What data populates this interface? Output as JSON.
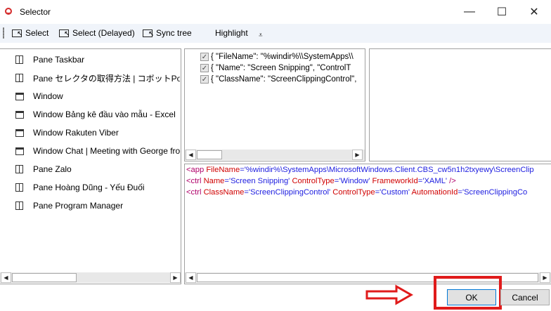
{
  "window": {
    "title": "Selector",
    "icon": "selector-app-icon",
    "controls": {
      "minimize": "—",
      "maximize": "☐",
      "close": "✕"
    }
  },
  "toolbar": {
    "select": "Select",
    "select_delayed": "Select (Delayed)",
    "sync_tree": "Sync tree",
    "highlight": "Highlight",
    "highlight_dropdown": "⩡"
  },
  "tree": {
    "items": [
      {
        "icon": "pane-icon",
        "label": "Pane Taskbar"
      },
      {
        "icon": "pane-icon",
        "label": "Pane セレクタの取得方法 | コボットPortal - "
      },
      {
        "icon": "window-icon",
        "label": "Window"
      },
      {
        "icon": "window-icon",
        "label": "Window Bảng kê đầu vào mẫu - Excel"
      },
      {
        "icon": "window-icon",
        "label": "Window Rakuten Viber"
      },
      {
        "icon": "window-icon",
        "label": "Window Chat | Meeting with George fro"
      },
      {
        "icon": "pane-icon",
        "label": "Pane Zalo"
      },
      {
        "icon": "pane-icon",
        "label": "Pane Hoàng Dũng - Yếu Đuối"
      },
      {
        "icon": "pane-icon",
        "label": "Pane Program Manager"
      }
    ]
  },
  "attributes": {
    "rows": [
      {
        "checked": true,
        "text": "{   \"FileName\": \"%windir%\\\\SystemApps\\\\"
      },
      {
        "checked": true,
        "text": "{   \"Name\": \"Screen Snipping\",    \"ControlT"
      },
      {
        "checked": true,
        "text": "{   \"ClassName\": \"ScreenClippingControl\","
      }
    ]
  },
  "xml": {
    "lines": [
      {
        "tag": "<app",
        "attr": "FileName",
        "value": "'%windir%\\SystemApps\\MicrosoftWindows.Client.CBS_cw5n1h2txyewy\\ScreenClip"
      },
      {
        "tag": "<ctrl",
        "attr": "Name",
        "value": "'Screen Snipping' ",
        "attr2": "ControlType",
        "value2": "'Window' ",
        "attr3": "FrameworkId",
        "value3": "'XAML' ",
        "end": "/>"
      },
      {
        "tag": "<ctrl",
        "attr": "ClassName",
        "value": "'ScreenClippingControl' ",
        "attr2": "ControlType",
        "value2": "'Custom' ",
        "attr3": "AutomationId",
        "value3": "'ScreenClippingCo"
      }
    ]
  },
  "buttons": {
    "ok": "OK",
    "cancel": "Cancel"
  },
  "scroll": {
    "left": "◀",
    "right": "▶"
  },
  "colors": {
    "annotation_red": "#e01b1b",
    "ok_border": "#0078d7",
    "toolbar_bg": "#f0f4fa"
  }
}
